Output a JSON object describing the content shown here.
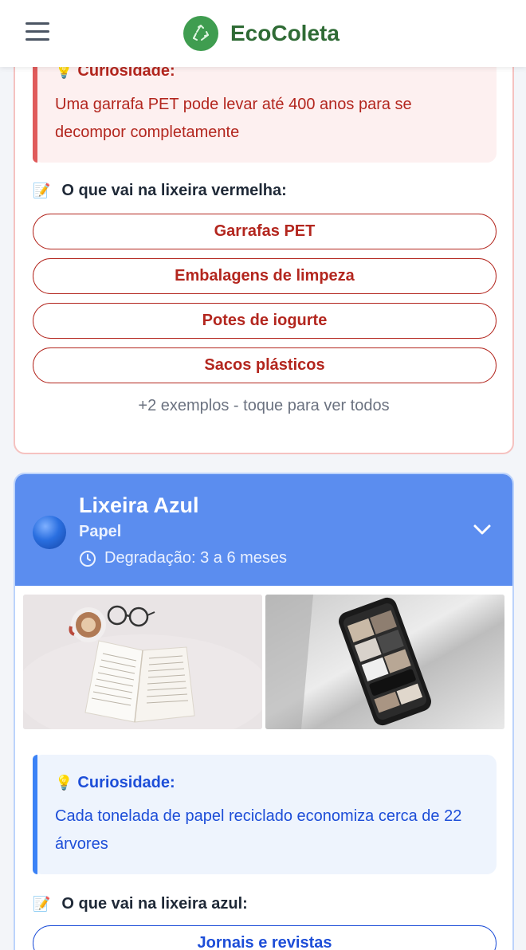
{
  "header": {
    "app_name": "EcoColeta",
    "menu_icon": "hamburger-menu-icon",
    "logo_icon": "recycle-icon",
    "brand_color": "#2f6b35"
  },
  "red_bin": {
    "color": "#b3261e",
    "curiosity": {
      "title": "Curiosidade:",
      "text": "Uma garrafa PET pode levar até 400 anos para se decompor completamente"
    },
    "list_title": "O que vai na lixeira vermelha:",
    "items": [
      "Garrafas PET",
      "Embalagens de limpeza",
      "Potes de iogurte",
      "Sacos plásticos"
    ],
    "more": "+2 exemplos - toque para ver todos"
  },
  "blue_bin": {
    "color": "#5b8def",
    "title": "Lixeira Azul",
    "subtitle": "Papel",
    "degradation": "Degradação: 3 a 6 meses",
    "curiosity": {
      "title": "Curiosidade:",
      "text": "Cada tonelada de papel reciclado economiza cerca de 22 árvores"
    },
    "list_title": "O que vai na lixeira azul:",
    "items": [
      "Jornais e revistas"
    ]
  }
}
